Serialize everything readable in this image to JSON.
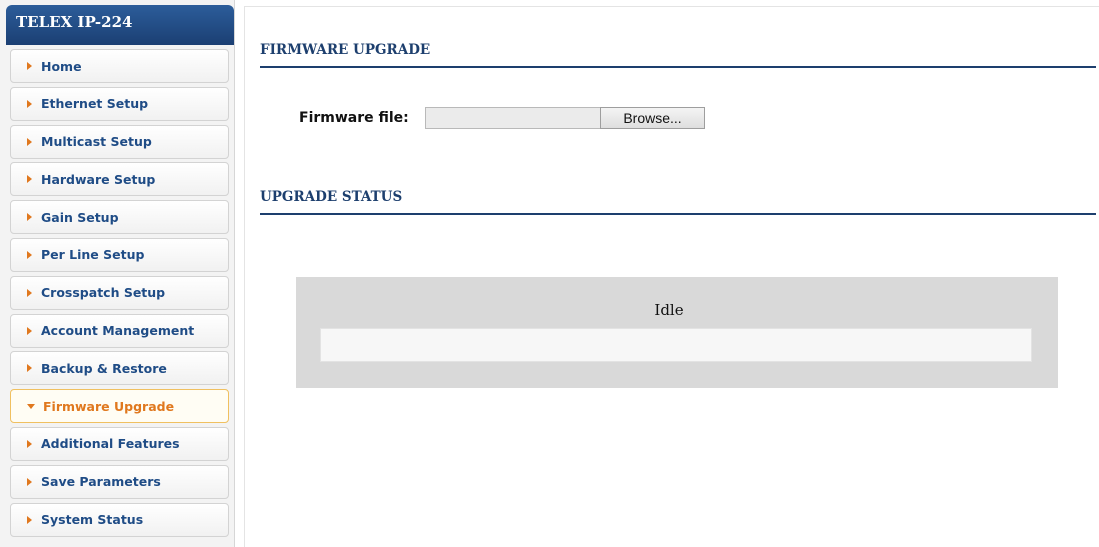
{
  "device": {
    "title": "TELEX IP-224"
  },
  "sidebar": {
    "items": [
      {
        "label": "Home"
      },
      {
        "label": "Ethernet Setup"
      },
      {
        "label": "Multicast Setup"
      },
      {
        "label": "Hardware Setup"
      },
      {
        "label": "Gain Setup"
      },
      {
        "label": "Per Line Setup"
      },
      {
        "label": "Crosspatch Setup"
      },
      {
        "label": "Account Management"
      },
      {
        "label": "Backup & Restore"
      },
      {
        "label": "Firmware Upgrade",
        "active": true
      },
      {
        "label": "Additional Features"
      },
      {
        "label": "Save Parameters"
      },
      {
        "label": "System Status"
      }
    ]
  },
  "firmware": {
    "section_title": "FIRMWARE UPGRADE",
    "file_label": "Firmware file:",
    "file_value": "",
    "browse_label": "Browse..."
  },
  "status": {
    "section_title": "UPGRADE STATUS",
    "text": "Idle",
    "progress_percent": 0
  },
  "colors": {
    "accent": "#1d3f6e",
    "active": "#e0781e",
    "nav_text": "#1f4c86"
  }
}
